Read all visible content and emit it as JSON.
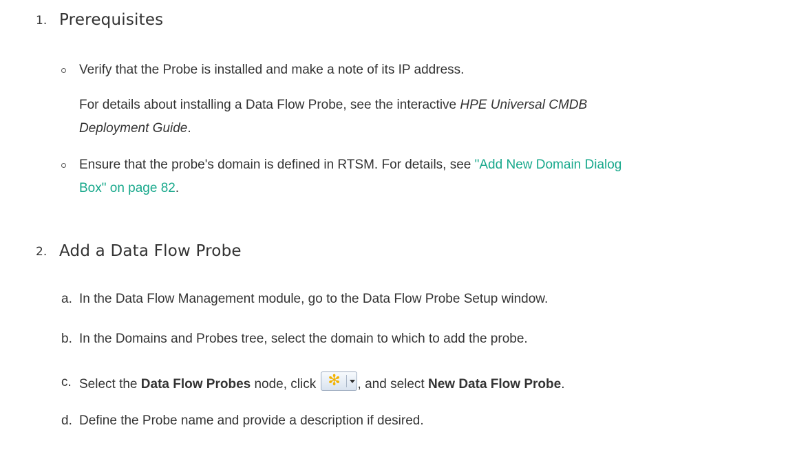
{
  "sections": [
    {
      "number": "1.",
      "title": "Prerequisites",
      "bullets": [
        {
          "text": "Verify that the Probe is installed and make a note of its IP address.",
          "note_prefix": "For details about installing a Data Flow Probe, see the interactive ",
          "note_italic_1": "HPE Universal CMDB",
          "note_italic_2": "Deployment Guide",
          "note_suffix": "."
        },
        {
          "text_prefix": "Ensure that the probe's domain is defined in RTSM. For details, see ",
          "link_line1": "\"Add New Domain Dialog",
          "link_line2": "Box\" on page 82",
          "text_suffix": "."
        }
      ]
    },
    {
      "number": "2.",
      "title": "Add a Data Flow Probe",
      "steps": [
        {
          "letter": "a.",
          "text": "In the Data Flow Management module, go to the Data Flow Probe Setup window."
        },
        {
          "letter": "b.",
          "text": "In the Domains and Probes tree, select the domain to which to add the probe."
        },
        {
          "letter": "c.",
          "text_1": "Select the ",
          "bold_1": "Data Flow Probes",
          "text_2": " node, click ",
          "text_3": ", and select ",
          "bold_2": "New Data Flow Probe",
          "text_4": "."
        },
        {
          "letter": "d.",
          "text": "Define the Probe name and provide a description if desired."
        }
      ]
    }
  ],
  "toolbar_button": {
    "icon": "new-star-icon",
    "dropdown_icon": "chevron-down-icon"
  },
  "colors": {
    "text": "#333333",
    "link": "#17a88b",
    "icon": "#f2b200"
  }
}
